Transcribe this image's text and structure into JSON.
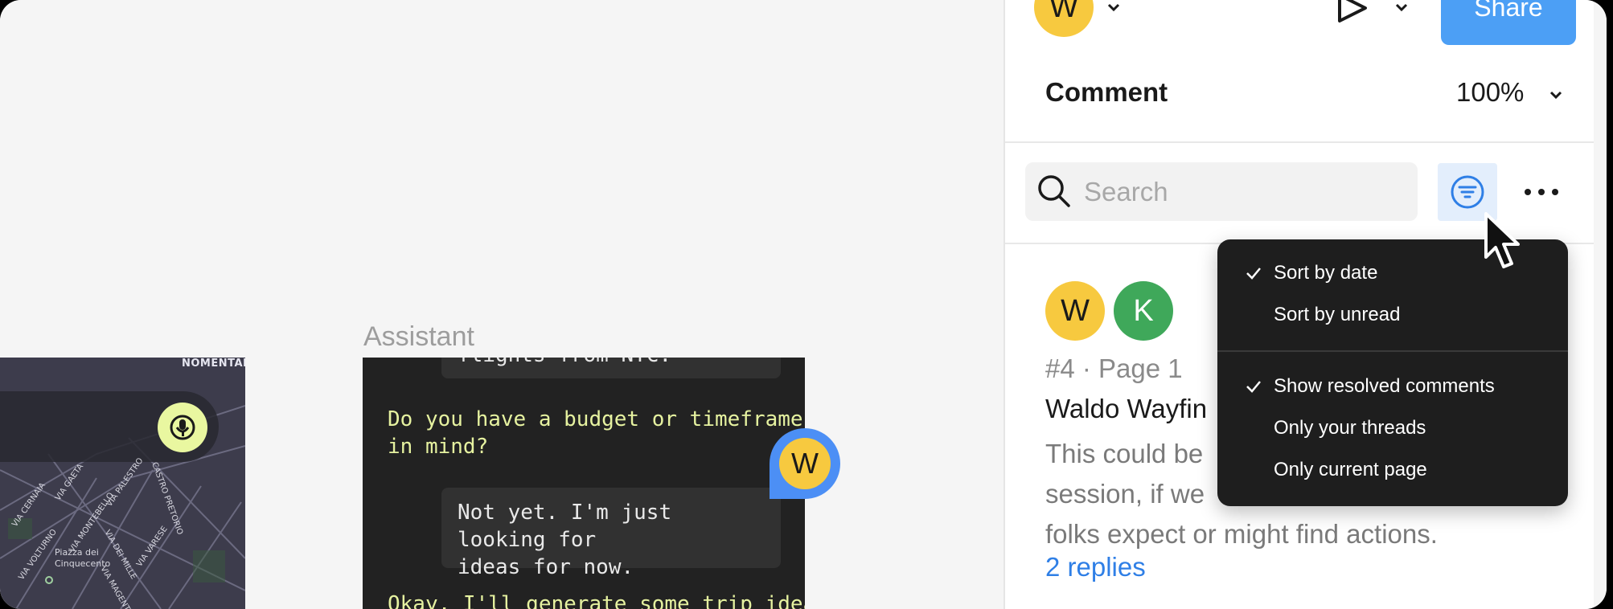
{
  "canvas": {
    "frame_label": "Assistant",
    "map": {
      "label_top": "NOMENTANO",
      "streets": [
        "VIA CERNAIA",
        "VIA GAETA",
        "VIA VOLTURNO",
        "VIA MONTEBELLO",
        "VIA PALESTRO",
        "CASTRO PRETORIO",
        "VIA DEI MILLE",
        "VIA VARESE",
        "VIA MAGENTA"
      ],
      "place": [
        "Piazza dei",
        "Cinquecento"
      ]
    },
    "chat": {
      "top_partial": "flights from NYC.",
      "assistant_1": [
        "Do you have a budget or timeframe",
        "in mind?"
      ],
      "user_2": [
        "Not yet. I'm just looking for",
        "ideas for now."
      ],
      "assistant_3_partial": "Okay, I'll generate some trip ideas"
    },
    "pin_avatar": "W"
  },
  "header": {
    "user_avatar": "W",
    "share_label": "Share"
  },
  "panel": {
    "title": "Comment",
    "zoom": "100%",
    "search": {
      "placeholder": "Search",
      "value": ""
    },
    "thread": {
      "avatars": [
        "W",
        "K"
      ],
      "meta": "#4 · Page 1",
      "title": "Waldo Wayfin",
      "body": [
        "This could be",
        "session, if we",
        "folks expect or might find actions."
      ],
      "replies": "2 replies"
    }
  },
  "filter_menu": {
    "items": [
      {
        "label": "Sort by date",
        "checked": true
      },
      {
        "label": "Sort by unread",
        "checked": false
      },
      {
        "label": "Show resolved comments",
        "checked": true
      },
      {
        "label": "Only your threads",
        "checked": false
      },
      {
        "label": "Only current page",
        "checked": false
      }
    ]
  },
  "colors": {
    "accent": "#4c9ff5",
    "avatar_w": "#f7c93f",
    "avatar_k": "#3fa85a",
    "assistant_text": "#e6f2a0",
    "menu_bg": "#1e1e1e"
  }
}
